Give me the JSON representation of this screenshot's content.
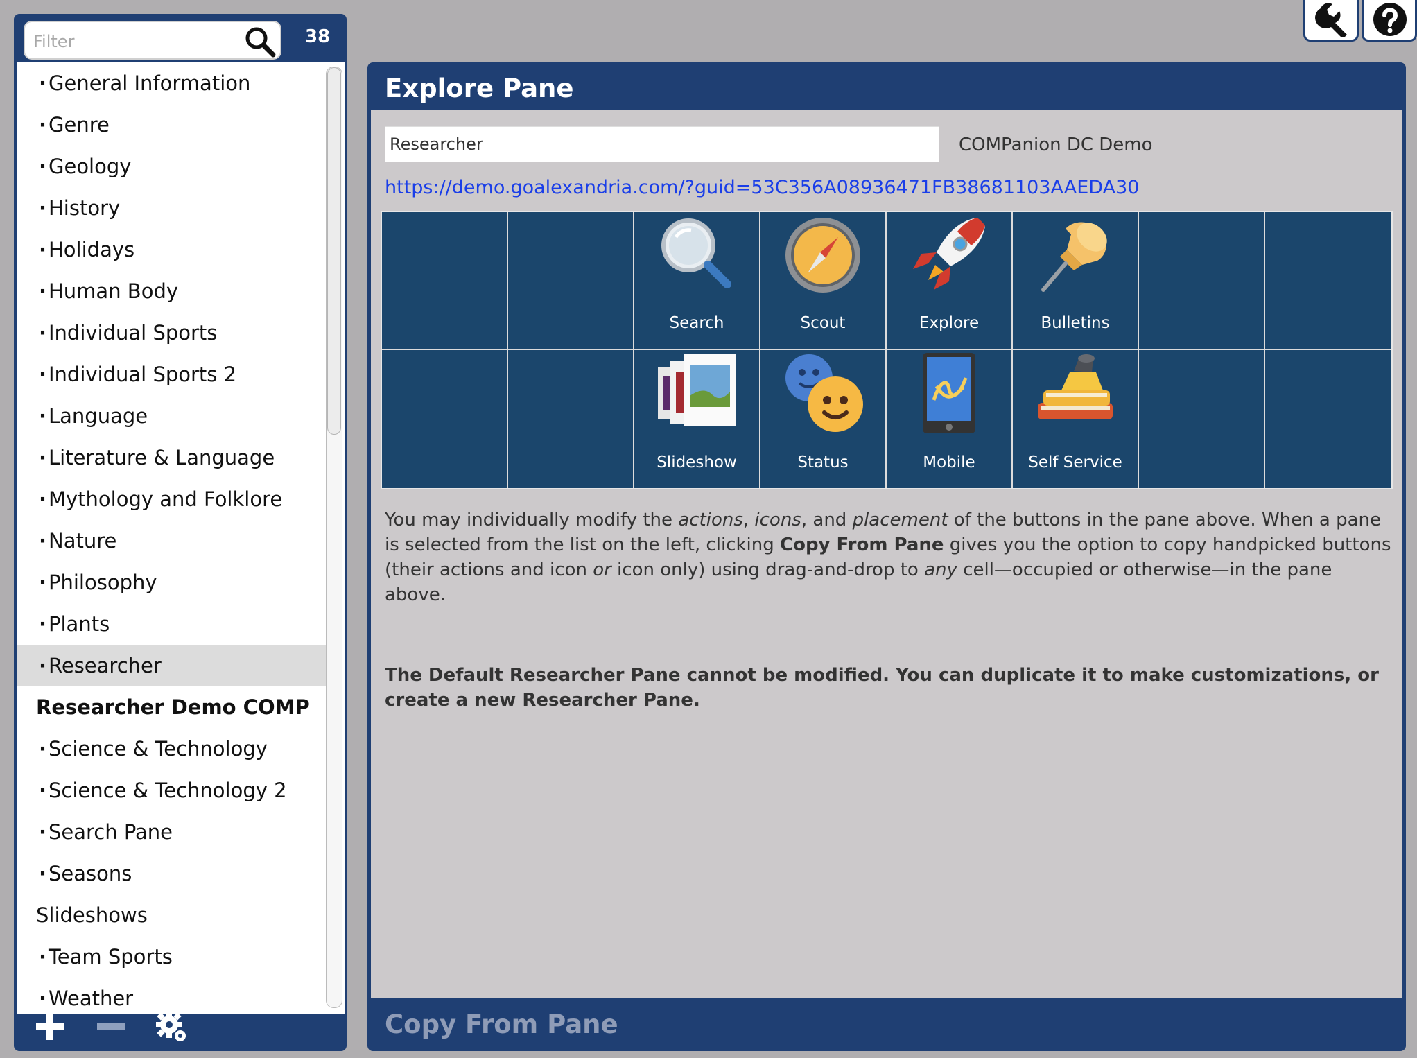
{
  "filter": {
    "placeholder": "Filter",
    "count": "38"
  },
  "sidebar": {
    "items": [
      {
        "label": "General Information",
        "type": "child"
      },
      {
        "label": "Genre",
        "type": "child"
      },
      {
        "label": "Geology",
        "type": "child"
      },
      {
        "label": "History",
        "type": "child"
      },
      {
        "label": "Holidays",
        "type": "child"
      },
      {
        "label": "Human Body",
        "type": "child"
      },
      {
        "label": "Individual Sports",
        "type": "child"
      },
      {
        "label": "Individual Sports 2",
        "type": "child"
      },
      {
        "label": "Language",
        "type": "child"
      },
      {
        "label": "Literature & Language",
        "type": "child"
      },
      {
        "label": "Mythology and Folklore",
        "type": "child"
      },
      {
        "label": "Nature",
        "type": "child"
      },
      {
        "label": "Philosophy",
        "type": "child"
      },
      {
        "label": "Plants",
        "type": "child"
      },
      {
        "label": "Researcher",
        "type": "child",
        "selected": true
      },
      {
        "label": "Researcher Demo COMP",
        "type": "parent-bold"
      },
      {
        "label": "Science & Technology",
        "type": "child"
      },
      {
        "label": "Science & Technology 2",
        "type": "child"
      },
      {
        "label": "Search Pane",
        "type": "child"
      },
      {
        "label": "Seasons",
        "type": "child"
      },
      {
        "label": "Slideshows",
        "type": "parent"
      },
      {
        "label": "Team Sports",
        "type": "child"
      },
      {
        "label": "Weather",
        "type": "child"
      }
    ],
    "toolbar_icons": [
      "plus-icon",
      "minus-icon",
      "gear-icon"
    ]
  },
  "top_buttons": [
    "wrench-icon",
    "help-icon"
  ],
  "main": {
    "title": "Explore Pane",
    "pane_name_value": "Researcher",
    "organization": "COMPanion DC Demo",
    "url": "https://demo.goalexandria.com/?guid=53C356A08936471FB38681103AAEDA30",
    "grid": {
      "rows": [
        [
          "",
          "",
          "Search",
          "Scout",
          "Explore",
          "Bulletins",
          "",
          ""
        ],
        [
          "",
          "",
          "Slideshow",
          "Status",
          "Mobile",
          "Self Service",
          "",
          ""
        ]
      ],
      "icons": {
        "Search": "magnifier-icon",
        "Scout": "compass-icon",
        "Explore": "rocket-icon",
        "Bulletins": "pushpin-icon",
        "Slideshow": "slideshow-icon",
        "Status": "smiley-icon",
        "Mobile": "mobile-phone-icon",
        "Self Service": "books-scanner-icon"
      }
    },
    "description": {
      "p1": "You may individually modify the ",
      "e1": "actions",
      "p2": ", ",
      "e2": "icons",
      "p3": ", and ",
      "e3": "placement",
      "p4": " of the buttons in the pane above. When a pane is selected from the list on the left, clicking ",
      "b1": "Copy From Pane",
      "p5": " gives you the option to copy handpicked buttons (their actions and icon ",
      "e4": "or",
      "p6": " icon only) using drag-and-drop to ",
      "e5": "any",
      "p7": " cell—occupied or otherwise—in the pane above."
    },
    "notice": "The Default Researcher Pane cannot be modified. You can duplicate it to make customizations, or create a new Researcher Pane.",
    "copy_from_pane": "Copy From Pane"
  },
  "colors": {
    "header": "#1f3f73",
    "grid_bg": "#1b466c",
    "content_bg": "#ccc9cb",
    "link": "#1a3ee8"
  }
}
